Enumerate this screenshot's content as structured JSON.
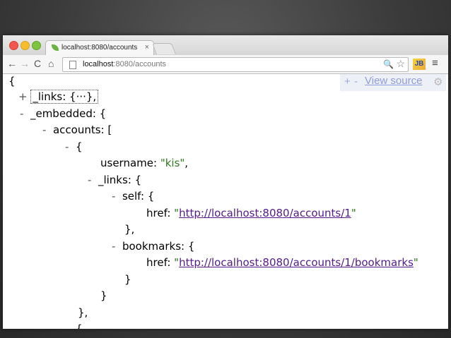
{
  "browser": {
    "tab_title": "localhost:8080/accounts",
    "tab_close": "×",
    "url_host": "localhost",
    "url_rest": ":8080/accounts",
    "jb_label": "JB",
    "icons": {
      "back": "←",
      "forward": "→",
      "reload": "C",
      "home": "⌂",
      "zoom": "🔍",
      "star": "☆",
      "menu": "≡"
    }
  },
  "viewer": {
    "plus": "+",
    "minus": "-",
    "view_source": "View source",
    "gear": "⚙"
  },
  "json_tree": {
    "open_brace": "{",
    "links_key": "_links",
    "links_collapsed": "{···},",
    "embedded_key": "_embedded",
    "accounts_key": "accounts",
    "username_key": "username",
    "username_value": "\"kis\"",
    "item_links_key": "_links",
    "self_key": "self",
    "href_key": "href",
    "self_href": "http://localhost:8080/accounts/1",
    "bookmarks_key": "bookmarks",
    "bookmarks_href": "http://localhost:8080/accounts/1/bookmarks",
    "close_brace_comma": "},",
    "close_brace": "}",
    "toggle_plus": "+",
    "toggle_minus": "-"
  }
}
